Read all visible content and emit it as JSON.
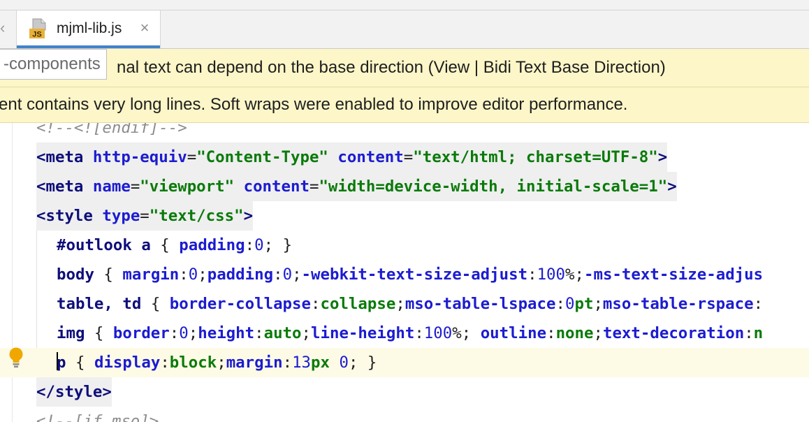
{
  "tab": {
    "file_label": "mjml-lib.js",
    "icon_text": "JS",
    "close_glyph": "×",
    "scroll_left_glyph": "‹"
  },
  "breadcrumb_tooltip": "-components",
  "banners": {
    "bidi_notice": "nal text can depend on the base direction (View | Bidi Text Base Direction)",
    "long_lines_notice": "ent contains very long lines. Soft wraps were enabled to improve editor performance."
  },
  "editor": {
    "lines": [
      {
        "id": "comment-endif",
        "tokens": [
          {
            "t": "<!--<![endif]-->",
            "c": "comment"
          }
        ]
      },
      {
        "id": "meta-content-type",
        "tokens": [
          {
            "t": "<meta ",
            "c": "tag"
          },
          {
            "t": "http-equiv",
            "c": "attr"
          },
          {
            "t": "=",
            "c": "punct"
          },
          {
            "t": "\"Content-Type\"",
            "c": "val"
          },
          {
            "t": " ",
            "c": "punct"
          },
          {
            "t": "content",
            "c": "attr"
          },
          {
            "t": "=",
            "c": "punct"
          },
          {
            "t": "\"text/html; charset=UTF-8\"",
            "c": "val"
          },
          {
            "t": ">",
            "c": "tag"
          }
        ]
      },
      {
        "id": "meta-viewport",
        "tokens": [
          {
            "t": "<meta ",
            "c": "tag"
          },
          {
            "t": "name",
            "c": "attr"
          },
          {
            "t": "=",
            "c": "punct"
          },
          {
            "t": "\"viewport\"",
            "c": "val"
          },
          {
            "t": " ",
            "c": "punct"
          },
          {
            "t": "content",
            "c": "attr"
          },
          {
            "t": "=",
            "c": "punct"
          },
          {
            "t": "\"width=device-width, initial-scale=1\"",
            "c": "val"
          },
          {
            "t": ">",
            "c": "tag"
          }
        ]
      },
      {
        "id": "style-open",
        "tokens": [
          {
            "t": "<style ",
            "c": "tag"
          },
          {
            "t": "type",
            "c": "attr"
          },
          {
            "t": "=",
            "c": "punct"
          },
          {
            "t": "\"text/css\"",
            "c": "val"
          },
          {
            "t": ">",
            "c": "tag"
          }
        ]
      },
      {
        "id": "css-outlook",
        "tokens": [
          {
            "t": "#outlook a ",
            "c": "sel"
          },
          {
            "t": "{ ",
            "c": "punct"
          },
          {
            "t": "padding",
            "c": "prop"
          },
          {
            "t": ":",
            "c": "punct"
          },
          {
            "t": "0",
            "c": "num"
          },
          {
            "t": "; }",
            "c": "punct"
          }
        ]
      },
      {
        "id": "css-body",
        "tokens": [
          {
            "t": "body ",
            "c": "sel"
          },
          {
            "t": "{ ",
            "c": "punct"
          },
          {
            "t": "margin",
            "c": "prop"
          },
          {
            "t": ":",
            "c": "punct"
          },
          {
            "t": "0",
            "c": "num"
          },
          {
            "t": ";",
            "c": "punct"
          },
          {
            "t": "padding",
            "c": "prop"
          },
          {
            "t": ":",
            "c": "punct"
          },
          {
            "t": "0",
            "c": "num"
          },
          {
            "t": ";",
            "c": "punct"
          },
          {
            "t": "-webkit-text-size-adjust",
            "c": "prop"
          },
          {
            "t": ":",
            "c": "punct"
          },
          {
            "t": "100",
            "c": "num"
          },
          {
            "t": "%;",
            "c": "punct"
          },
          {
            "t": "-ms-text-size-adjus",
            "c": "prop"
          }
        ]
      },
      {
        "id": "css-table",
        "tokens": [
          {
            "t": "table, td ",
            "c": "sel"
          },
          {
            "t": "{ ",
            "c": "punct"
          },
          {
            "t": "border-collapse",
            "c": "prop"
          },
          {
            "t": ":",
            "c": "punct"
          },
          {
            "t": "collapse",
            "c": "kw"
          },
          {
            "t": ";",
            "c": "punct"
          },
          {
            "t": "mso-table-lspace",
            "c": "prop"
          },
          {
            "t": ":",
            "c": "punct"
          },
          {
            "t": "0",
            "c": "num"
          },
          {
            "t": "pt",
            "c": "kw"
          },
          {
            "t": ";",
            "c": "punct"
          },
          {
            "t": "mso-table-rspace",
            "c": "prop"
          },
          {
            "t": ":",
            "c": "punct"
          }
        ]
      },
      {
        "id": "css-img",
        "tokens": [
          {
            "t": "img ",
            "c": "sel"
          },
          {
            "t": "{ ",
            "c": "punct"
          },
          {
            "t": "border",
            "c": "prop"
          },
          {
            "t": ":",
            "c": "punct"
          },
          {
            "t": "0",
            "c": "num"
          },
          {
            "t": ";",
            "c": "punct"
          },
          {
            "t": "height",
            "c": "prop"
          },
          {
            "t": ":",
            "c": "punct"
          },
          {
            "t": "auto",
            "c": "kw"
          },
          {
            "t": ";",
            "c": "punct"
          },
          {
            "t": "line-height",
            "c": "prop"
          },
          {
            "t": ":",
            "c": "punct"
          },
          {
            "t": "100",
            "c": "num"
          },
          {
            "t": "%; ",
            "c": "punct"
          },
          {
            "t": "outline",
            "c": "prop"
          },
          {
            "t": ":",
            "c": "punct"
          },
          {
            "t": "none",
            "c": "kw"
          },
          {
            "t": ";",
            "c": "punct"
          },
          {
            "t": "text-decoration",
            "c": "prop"
          },
          {
            "t": ":",
            "c": "punct"
          },
          {
            "t": "n",
            "c": "kw"
          }
        ]
      },
      {
        "id": "css-p",
        "caret": true,
        "tokens": [
          {
            "t": "p ",
            "c": "sel"
          },
          {
            "t": "{ ",
            "c": "punct"
          },
          {
            "t": "display",
            "c": "prop"
          },
          {
            "t": ":",
            "c": "punct"
          },
          {
            "t": "block",
            "c": "kw"
          },
          {
            "t": ";",
            "c": "punct"
          },
          {
            "t": "margin",
            "c": "prop"
          },
          {
            "t": ":",
            "c": "punct"
          },
          {
            "t": "13",
            "c": "num"
          },
          {
            "t": "px ",
            "c": "kw"
          },
          {
            "t": "0",
            "c": "num"
          },
          {
            "t": "; }",
            "c": "punct"
          }
        ]
      },
      {
        "id": "style-close",
        "tokens": [
          {
            "t": "</style>",
            "c": "tag"
          }
        ]
      },
      {
        "id": "comment-if-mso",
        "tokens": [
          {
            "t": "<!--[if mso]>",
            "c": "comment"
          }
        ]
      }
    ]
  },
  "colors": {
    "banner_bg": "#fcf6c8",
    "tab_underline": "#4083c9",
    "bulb": "#f0a800"
  },
  "icons": {
    "file_icon": "js-file-icon",
    "bulb": "lightbulb-icon"
  }
}
